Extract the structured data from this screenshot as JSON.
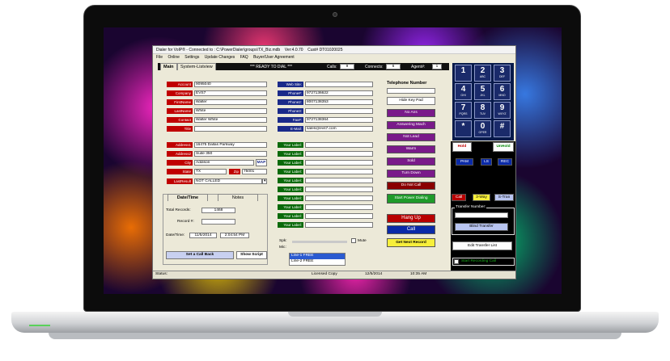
{
  "window": {
    "title": "Dialer for VoIP® - Connected to : C:\\PowerDialer\\groups\\TX_Biz.mdb",
    "version": "Ver:4.0.70",
    "cust": "Cust# DT01020025"
  },
  "menu": [
    "File",
    "Online",
    "Settings",
    "Update Changes",
    "FAQ",
    "Buyer/User Agreement"
  ],
  "tabs": {
    "main": "Main",
    "system": "System-Listview"
  },
  "status": {
    "ready": "*** READY TO DIAL ***",
    "calls_label": "Calls:",
    "calls": "9",
    "connects_label": "Connects:",
    "connects": "6",
    "agent_label": "Agent#:",
    "agent": "1"
  },
  "contact": {
    "account_label": "Account",
    "account": "9095040",
    "company_label": "Company",
    "company": "EVS7",
    "firstname_label": "FirstName",
    "firstname": "Walter",
    "lastname_label": "LastName",
    "lastname": "White",
    "contact_label": "Contact",
    "contact": "Walter White",
    "title_label": "Title",
    "title": "",
    "address1_label": "Address1",
    "address1": "16475 Dallas Parkway",
    "address2_label": "Address2",
    "address2": "Suite 350",
    "city_label": "City",
    "city": "Addison",
    "map": "MAP",
    "state_label": "State",
    "state": "TX",
    "zip_label": "Zip",
    "zip": "75001",
    "lastresult_label": "LastResult",
    "lastresult": "NOT CALLED"
  },
  "web": {
    "website_label": "Web Site:",
    "website": "",
    "phone1_label": "Phone#:",
    "phone1": "9727136622",
    "phone2_label": "Phone2:",
    "phone2": "8007138353",
    "phone3_label": "Phone3:",
    "phone3": "",
    "fax_label": "Fax#:",
    "fax": "9727138364",
    "email_label": "E-Mail:",
    "email": "sales@evs7.com"
  },
  "custom": {
    "label": "Your Label:"
  },
  "datetime": {
    "tab1": "Date/Time",
    "tab2": "Notes",
    "total_label": "Total Records:",
    "total": "1468",
    "record_label": "Record #:",
    "record": "",
    "datetime_label": "Date/Time:",
    "date": "11/5/2014",
    "time": "2:04:54 PM"
  },
  "actions": {
    "callback": "Set a Call Back",
    "script": "Show Script"
  },
  "tel": {
    "header": "Telephone Number",
    "hide": "Hide Key Pad",
    "no_ans": "No Ans",
    "answering": "Answering Mach",
    "not_lead": "Not Lead",
    "warm": "Warm",
    "sold": "Sold",
    "turn_down": "Turn Down",
    "dnc": "Do Not Call",
    "start": "Start Power Dialing",
    "hangup": "Hang Up",
    "call": "Call",
    "next": "Get Next Record"
  },
  "audio": {
    "spk": "Spk:",
    "mic": "Mic:",
    "mute": "Mute"
  },
  "lines": [
    "Line-1  FREE",
    "Line-2  FREE"
  ],
  "keypad": [
    {
      "d": "1",
      "s": ""
    },
    {
      "d": "2",
      "s": "ABC"
    },
    {
      "d": "3",
      "s": "DEF"
    },
    {
      "d": "4",
      "s": "GHI"
    },
    {
      "d": "5",
      "s": "JKL"
    },
    {
      "d": "6",
      "s": "MNO"
    },
    {
      "d": "7",
      "s": "PQRS"
    },
    {
      "d": "8",
      "s": "TUV"
    },
    {
      "d": "9",
      "s": "WXYZ"
    },
    {
      "d": "*",
      "s": ""
    },
    {
      "d": "0",
      "s": "OPER"
    },
    {
      "d": "#",
      "s": ""
    }
  ],
  "phone_ctrl": {
    "hold": "Hold",
    "unhold": "UnHold",
    "pam": "PAM",
    "ls": "LS",
    "rec": "REC",
    "call": "Call",
    "threeway": "3-Way",
    "stran": "S-Tran",
    "transfer_label": "Transfer Number:",
    "blind": "Blind Transfer",
    "edit_list": "Edit Transfer List",
    "start_rec": "Start Recording Call"
  },
  "statusbar": {
    "status": "Status:",
    "license": "Licensed Copy",
    "date": "12/5/2014",
    "time": "10:35 AM"
  },
  "colors": {
    "red": "#c00000",
    "blue": "#1a2a8a",
    "green": "#0a6a0a",
    "purple": "#7a1a8a"
  }
}
